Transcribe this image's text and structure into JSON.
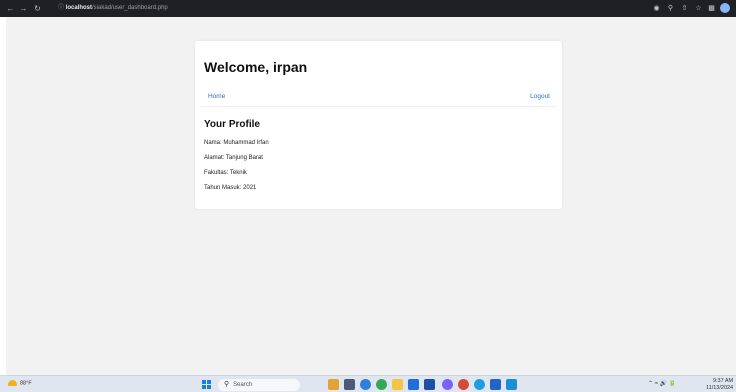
{
  "browser": {
    "address_host": "localhost",
    "address_path": "/siakad/user_dashboard.php"
  },
  "page": {
    "welcome_text": "Welcome, irpan",
    "nav": {
      "home_label": "Home",
      "logout_label": "Logout"
    },
    "profile_title": "Your Profile",
    "fields": [
      "Nama: Muhammad Irfan",
      "Alamat: Tanjung Barat",
      "Fakultas: Teknik",
      "Tahun Masuk: 2021"
    ]
  },
  "taskbar": {
    "weather": "88°F",
    "search_placeholder": "Search",
    "time": "9:37 AM",
    "date": "11/13/2024"
  },
  "colors": {
    "link": "#2b6fd6",
    "page_bg": "#f2f2f2",
    "card_bg": "#ffffff",
    "taskbar_bg": "#dfe6ef"
  }
}
